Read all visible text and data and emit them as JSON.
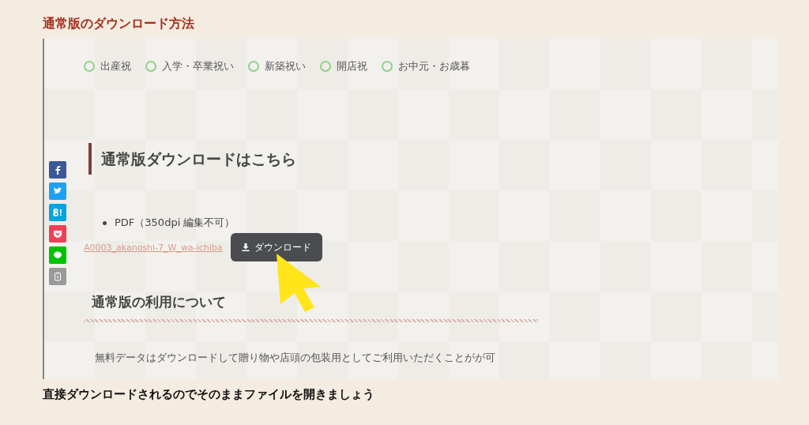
{
  "page_title": "通常版のダウンロード方法",
  "screenshot": {
    "categories": [
      "出産祝",
      "入学・卒業祝い",
      "新築祝い",
      "開店祝",
      "お中元・お歳暮"
    ],
    "share_buttons": [
      {
        "kind": "facebook",
        "color": "#3b5998"
      },
      {
        "kind": "twitter",
        "color": "#1da1f2"
      },
      {
        "kind": "hatena",
        "color": "#00a4de"
      },
      {
        "kind": "pocket",
        "color": "#ef3f56"
      },
      {
        "kind": "line",
        "color": "#00c300"
      },
      {
        "kind": "copy",
        "color": "#9a9a9a"
      }
    ],
    "download_heading": "通常版ダウンロードはこちら",
    "format_item": "PDF（350dpi 編集不可）",
    "file_link": "A0003_akanoshi-7_W_wa-ichiba",
    "download_button": "ダウンロード",
    "usage_heading": "通常版の利用について",
    "usage_text": "無料データはダウンロードして贈り物や店頭の包装用としてご利用いただくことがが可"
  },
  "caption": "直接ダウンロードされるのでそのままファイルを開きましょう"
}
